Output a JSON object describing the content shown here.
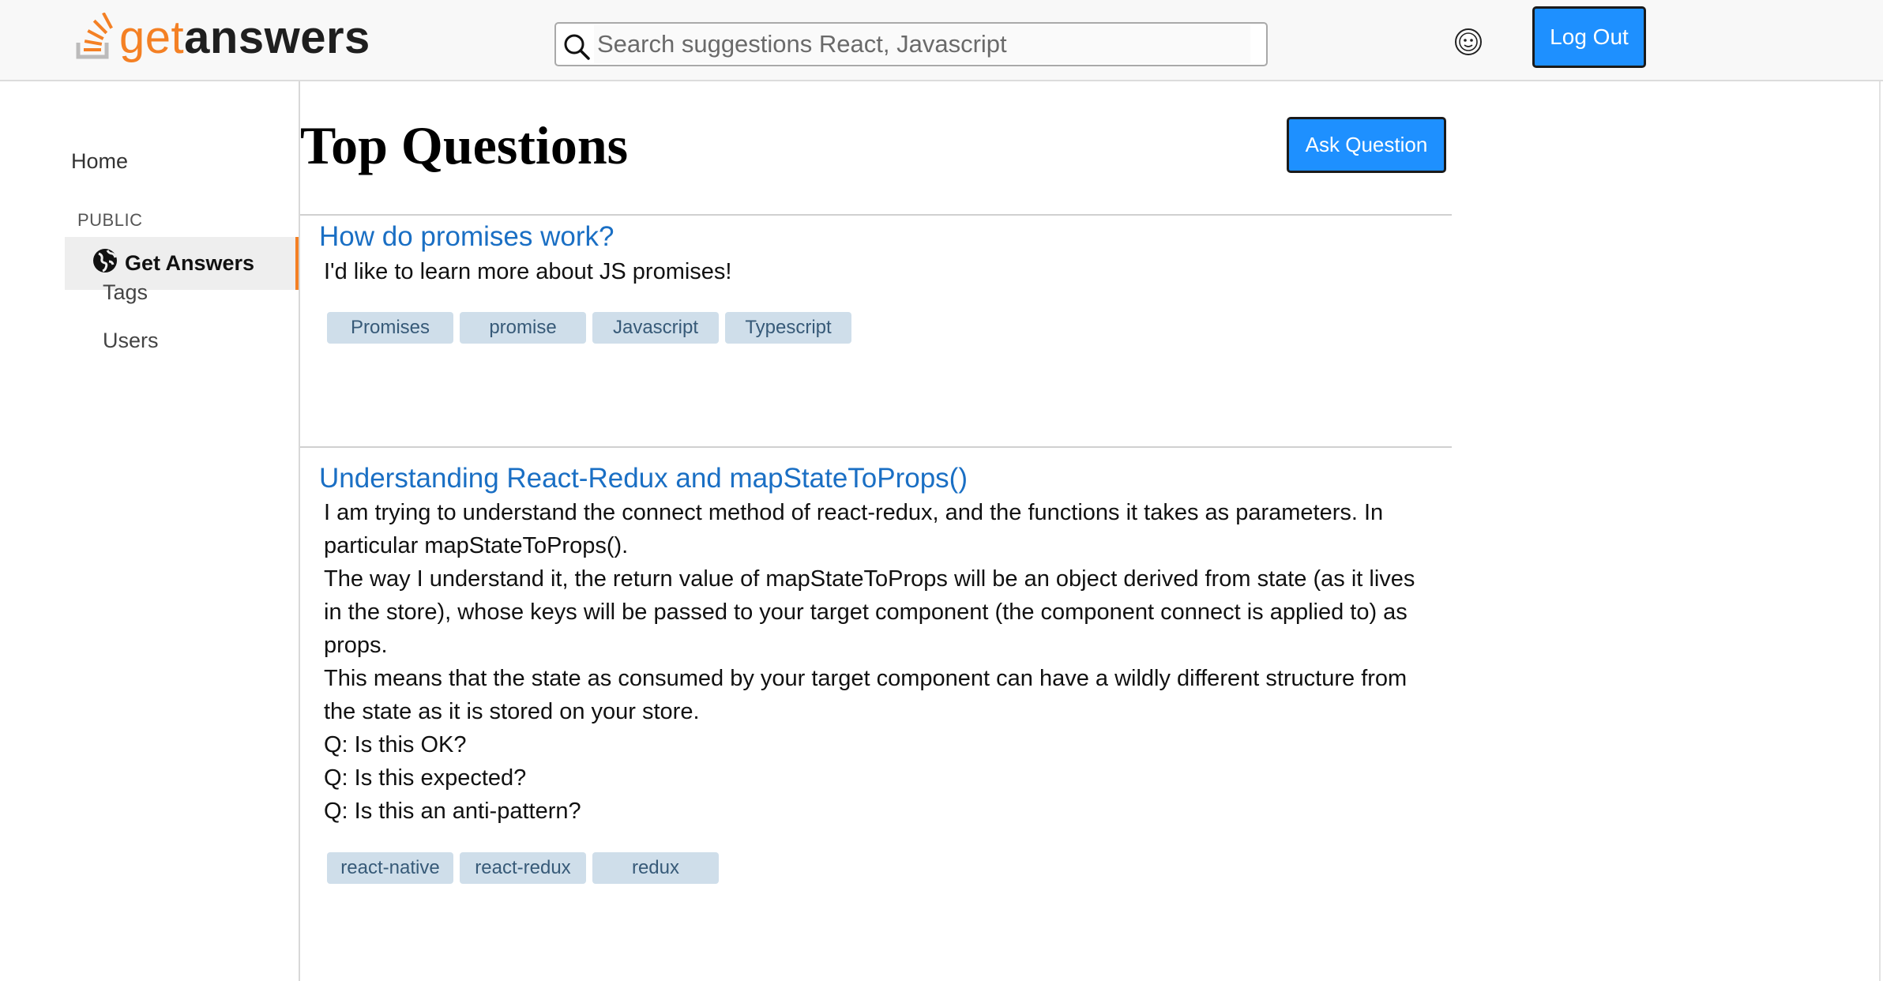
{
  "header": {
    "logo_get": "get",
    "logo_answers": "answers",
    "search_placeholder": "Search suggestions React, Javascript",
    "logout_label": "Log Out"
  },
  "sidebar": {
    "home": "Home",
    "section_label": "PUBLIC",
    "items": [
      {
        "label": "Get Answers",
        "icon": "globe-icon",
        "active": true
      },
      {
        "label": "Tags"
      },
      {
        "label": "Users"
      }
    ]
  },
  "main": {
    "title": "Top Questions",
    "ask_label": "Ask Question",
    "questions": [
      {
        "title": "How do promises work?",
        "body": [
          "I'd like to learn more about JS promises!"
        ],
        "tags": [
          "Promises",
          "promise",
          "Javascript",
          "Typescript"
        ]
      },
      {
        "title": "Understanding React-Redux and mapStateToProps()",
        "body": [
          "I am trying to understand the connect method of react-redux, and the functions it takes as parameters. In particular mapStateToProps().",
          "The way I understand it, the return value of mapStateToProps will be an object derived from state (as it lives in the store), whose keys will be passed to your target component (the component connect is applied to) as props.",
          "This means that the state as consumed by your target component can have a wildly different structure from the state as it is stored on your store.",
          "Q: Is this OK?",
          "Q: Is this expected?",
          "Q: Is this an anti-pattern?"
        ],
        "tags": [
          "react-native",
          "react-redux",
          "redux"
        ]
      }
    ]
  },
  "colors": {
    "brand_orange": "#f48024",
    "button_blue": "#1e90ff",
    "link_blue": "#1a6fc4",
    "tag_bg": "#cfdeea"
  }
}
